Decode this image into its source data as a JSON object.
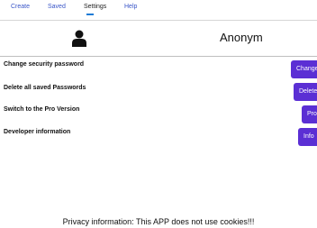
{
  "tabs": [
    {
      "label": "Create",
      "active": false
    },
    {
      "label": "Saved",
      "active": false
    },
    {
      "label": "Settings",
      "active": true
    },
    {
      "label": "Help",
      "active": false
    }
  ],
  "profile": {
    "avatar_icon": "person-icon",
    "username": "Anonym"
  },
  "settings": [
    {
      "label": "Change security password",
      "button": "Change"
    },
    {
      "label": "Delete all saved Passwords",
      "button": "Delete"
    },
    {
      "label": "Switch to the Pro Version",
      "button": "Pro"
    },
    {
      "label": "Developer information",
      "button": "Info"
    }
  ],
  "footer": {
    "privacy": "Privacy information: This APP does not use cookies!!!"
  },
  "colors": {
    "accent": "#5b2fd4",
    "tab_inactive": "#3a56c8",
    "tab_indicator": "#1e7bd6"
  }
}
